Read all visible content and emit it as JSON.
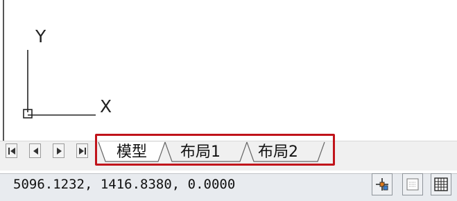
{
  "canvas": {
    "ucs_y_label": "Y",
    "ucs_x_label": "X"
  },
  "layout_tabs": {
    "tabs": [
      {
        "label": "模型",
        "active": true
      },
      {
        "label": "布局1",
        "active": false
      },
      {
        "label": "布局2",
        "active": false
      }
    ],
    "nav_buttons": [
      "first-tab",
      "previous-tab",
      "next-tab",
      "last-tab"
    ],
    "highlight_color": "#c0131a"
  },
  "status_bar": {
    "coordinates": "5096.1232, 1416.8380, 0.0000",
    "buttons": [
      "annotation-monitor-icon",
      "quick-properties-icon",
      "clean-screen-icon"
    ]
  }
}
